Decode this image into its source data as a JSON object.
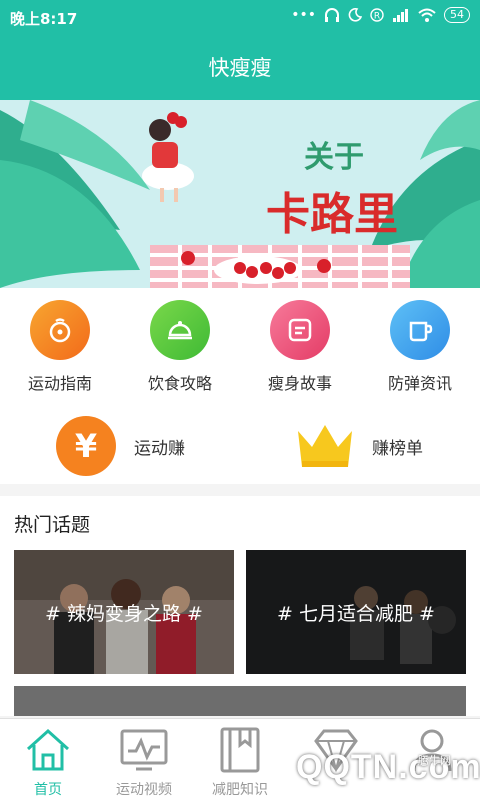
{
  "status": {
    "time": "晚上8:17",
    "battery": "54"
  },
  "app": {
    "title": "快瘦瘦"
  },
  "banner": {
    "line1": "关于",
    "line2": "卡路里"
  },
  "categories": [
    {
      "label": "运动指南",
      "icon": "stopwatch-icon"
    },
    {
      "label": "饮食攻略",
      "icon": "food-cover-icon"
    },
    {
      "label": "瘦身故事",
      "icon": "note-icon"
    },
    {
      "label": "防弹资讯",
      "icon": "cup-icon"
    }
  ],
  "earn": {
    "label": "运动赚",
    "icon_text": "¥"
  },
  "rank": {
    "label": "赚榜单"
  },
  "hot": {
    "title": "热门话题",
    "topics": [
      {
        "text": "# 辣妈变身之路 #"
      },
      {
        "text": "# 七月适合减肥 #"
      }
    ]
  },
  "tabs": [
    {
      "label": "首页",
      "icon": "home-icon"
    },
    {
      "label": "运动视频",
      "icon": "video-monitor-icon"
    },
    {
      "label": "减肥知识",
      "icon": "book-icon"
    },
    {
      "label": "",
      "icon": "diamond-icon"
    },
    {
      "label": "",
      "icon": "profile-icon"
    }
  ],
  "watermark": {
    "text": "QQTN.com",
    "small": "腾牛网"
  },
  "colors": {
    "primary": "#21bfa6",
    "orange": "#f5821f",
    "green": "#5fcc3e",
    "pink": "#ef5a7c",
    "blue": "#3ea6ef",
    "gold": "#f7c81e"
  }
}
